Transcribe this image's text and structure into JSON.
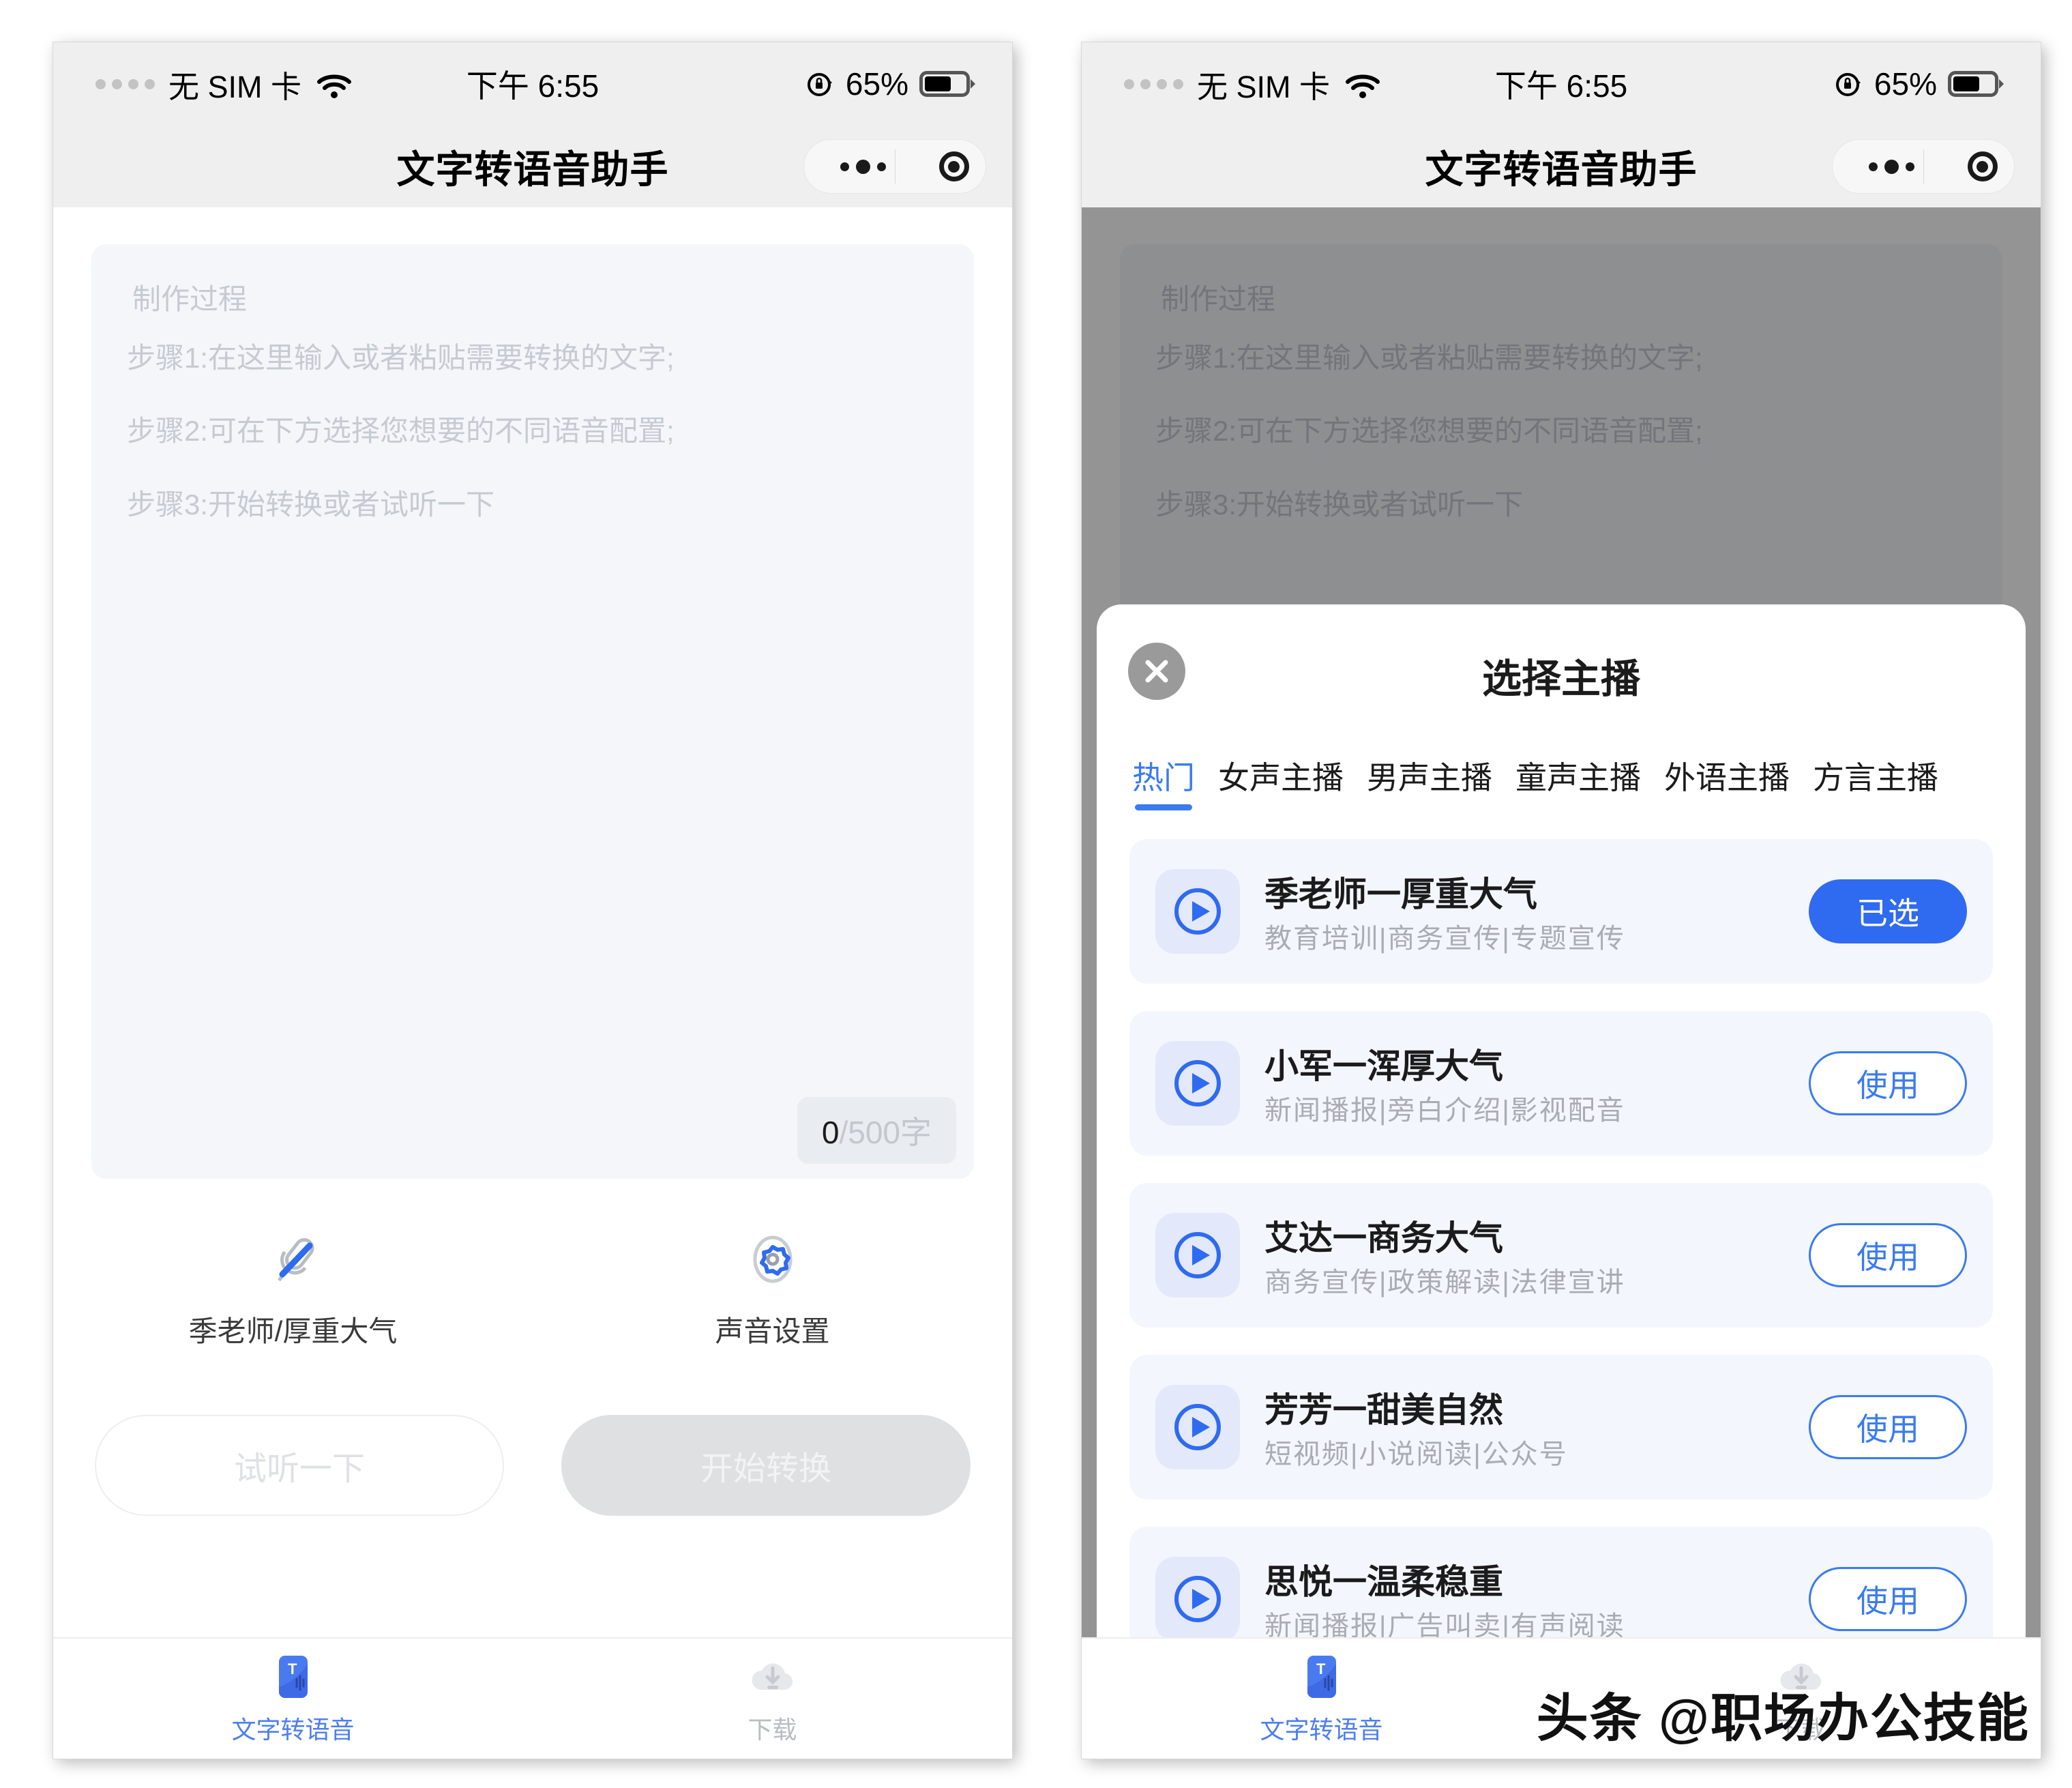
{
  "statusbar": {
    "carrier": "无 SIM 卡",
    "time": "下午 6:55",
    "battery_pct": "65%",
    "signal_icon": "signal-dots-icon",
    "wifi_icon": "wifi-icon",
    "rotation_lock_icon": "rotation-lock-icon",
    "battery_icon": "battery-icon"
  },
  "navbar": {
    "title": "文字转语音助手",
    "ellipsis_icon": "ellipsis-icon",
    "target_icon": "target-icon"
  },
  "editor": {
    "placeholder_title": "制作过程",
    "placeholder_steps": [
      "步骤1:在这里输入或者粘贴需要转换的文字;",
      "步骤2:可在下方选择您想要的不同语音配置;",
      "步骤3:开始转换或者试听一下"
    ],
    "count_current": "0",
    "count_limit": "/500字"
  },
  "controls": [
    {
      "icon": "microphone-icon",
      "label": "季老师/厚重大气"
    },
    {
      "icon": "gear-icon",
      "label": "声音设置"
    }
  ],
  "actions": {
    "preview_label": "试听一下",
    "convert_label": "开始转换"
  },
  "tabbar": [
    {
      "icon": "text-to-speech-icon",
      "label": "文字转语音",
      "active": true
    },
    {
      "icon": "download-cloud-icon",
      "label": "下载",
      "active": false
    }
  ],
  "sheet": {
    "title": "选择主播",
    "close_icon": "close-icon",
    "tabs": [
      {
        "label": "热门",
        "active": true
      },
      {
        "label": "女声主播",
        "active": false
      },
      {
        "label": "男声主播",
        "active": false
      },
      {
        "label": "童声主播",
        "active": false
      },
      {
        "label": "外语主播",
        "active": false
      },
      {
        "label": "方言主播",
        "active": false
      }
    ],
    "voices": [
      {
        "play_icon": "play-circle-icon",
        "name": "季老师一厚重大气",
        "tags": "教育培训|商务宣传|专题宣传",
        "action_label": "已选",
        "selected": true
      },
      {
        "play_icon": "play-circle-icon",
        "name": "小军一浑厚大气",
        "tags": "新闻播报|旁白介绍|影视配音",
        "action_label": "使用",
        "selected": false
      },
      {
        "play_icon": "play-circle-icon",
        "name": "艾达一商务大气",
        "tags": "商务宣传|政策解读|法律宣讲",
        "action_label": "使用",
        "selected": false
      },
      {
        "play_icon": "play-circle-icon",
        "name": "芳芳一甜美自然",
        "tags": "短视频|小说阅读|公众号",
        "action_label": "使用",
        "selected": false
      },
      {
        "play_icon": "play-circle-icon",
        "name": "思悦一温柔稳重",
        "tags": "新闻播报|广告叫卖|有声阅读",
        "action_label": "使用",
        "selected": false
      }
    ]
  },
  "watermark": "头条 @职场办公技能",
  "colors": {
    "accent_blue": "#3a7bf0",
    "selected_blue": "#2f6bf0",
    "tab_active": "#4e7ef0",
    "placeholder_gray": "#c6cad2",
    "panel_bg": "#f4f6fa"
  }
}
